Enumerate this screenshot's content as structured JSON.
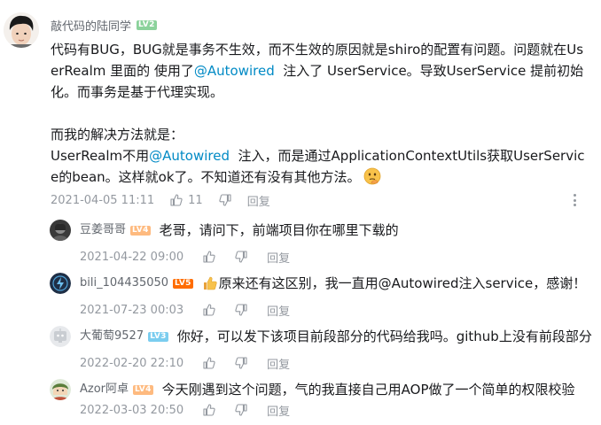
{
  "colors": {
    "username": "#61666d",
    "text": "#18191c",
    "meta": "#9499a0",
    "link": "#008ac5",
    "lv2": "#8bd29b",
    "lv3": "#7bcdef",
    "lv4": "#feba7f",
    "lv5": "#ff6c00"
  },
  "main": {
    "username": "敲代码的陆同学",
    "level": "LV2",
    "text_part1": "代码有BUG，BUG就是事务不生效，而不生效的原因就是shiro的配置有问题。问题就在UserRealm 里面的 使用了",
    "mention1": "@Autowired",
    "text_part2": "  注入了 UserService。导致UserService 提前初始化。而事务是基于代理实现。\n\n而我的解决方法就是：\nUserRealm不用",
    "mention2": "@Autowired",
    "text_part3": "  注入，而是通过ApplicationContextUtils获取UserService的bean。这样就ok了。不知道还有没有其他方法。",
    "emoji": "thinking-face",
    "time": "2021-04-05 11:11",
    "likes": "11",
    "reply_label": "回复"
  },
  "replies": [
    {
      "username": "豆姜哥哥",
      "level": "LV4",
      "content": "老哥，请问下，前端项目你在哪里下载的",
      "time": "2021-04-22 09:00",
      "reply_label": "回复"
    },
    {
      "username": "bili_104435050",
      "level": "LV5",
      "content_icon": "thumbs-up",
      "content": "原来还有这区别，我一直用@Autowired注入service，感谢！",
      "time": "2021-07-23 00:03",
      "reply_label": "回复"
    },
    {
      "username": "大葡萄9527",
      "level": "LV3",
      "content": "你好，可以发下该项目前段部分的代码给我吗。github上没有前段部分",
      "time": "2022-02-20 22:10",
      "reply_label": "回复"
    },
    {
      "username": "Azor阿卓",
      "level": "LV4",
      "content": "今天刚遇到这个问题，气的我直接自己用AOP做了一个简单的权限校验",
      "time": "2022-03-03 20:50",
      "reply_label": "回复"
    }
  ]
}
